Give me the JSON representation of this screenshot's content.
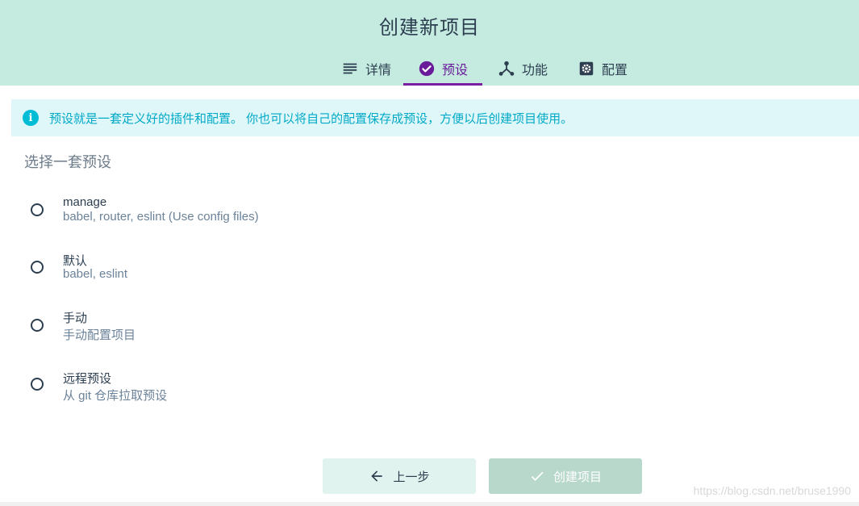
{
  "header": {
    "title": "创建新项目",
    "tabs": [
      {
        "label": "详情",
        "icon": "subject-icon",
        "selected": false
      },
      {
        "label": "预设",
        "icon": "check-circle-icon",
        "selected": true
      },
      {
        "label": "功能",
        "icon": "device-hub-icon",
        "selected": false
      },
      {
        "label": "配置",
        "icon": "settings-applications-icon",
        "selected": false
      }
    ]
  },
  "info": {
    "icon": "info-icon",
    "glyph": "i",
    "text": "预设就是一套定义好的插件和配置。 你也可以将自己的配置保存成预设，方便以后创建项目使用。"
  },
  "presets": {
    "title": "选择一套预设",
    "options": [
      {
        "name": "manage",
        "description": "babel, router, eslint (Use config files)",
        "checked": false
      },
      {
        "name": "默认",
        "description": "babel, eslint",
        "checked": false
      },
      {
        "name": "手动",
        "description": "手动配置项目",
        "checked": false
      },
      {
        "name": "远程预设",
        "description": "从 git 仓库拉取预设",
        "checked": false
      }
    ]
  },
  "actions": {
    "prev_label": "上一步",
    "create_label": "创建项目",
    "create_disabled": true
  },
  "watermark": "https://blog.csdn.net/bruse1990",
  "colors": {
    "header_bg": "#c5eadf",
    "accent": "#7b1fa2",
    "info_bg": "#e0f7fa",
    "info_text": "#00aac6",
    "info_icon": "#00bcd4",
    "prev_btn_bg": "#e1f3ee",
    "create_btn_bg": "#b8d8cc"
  }
}
